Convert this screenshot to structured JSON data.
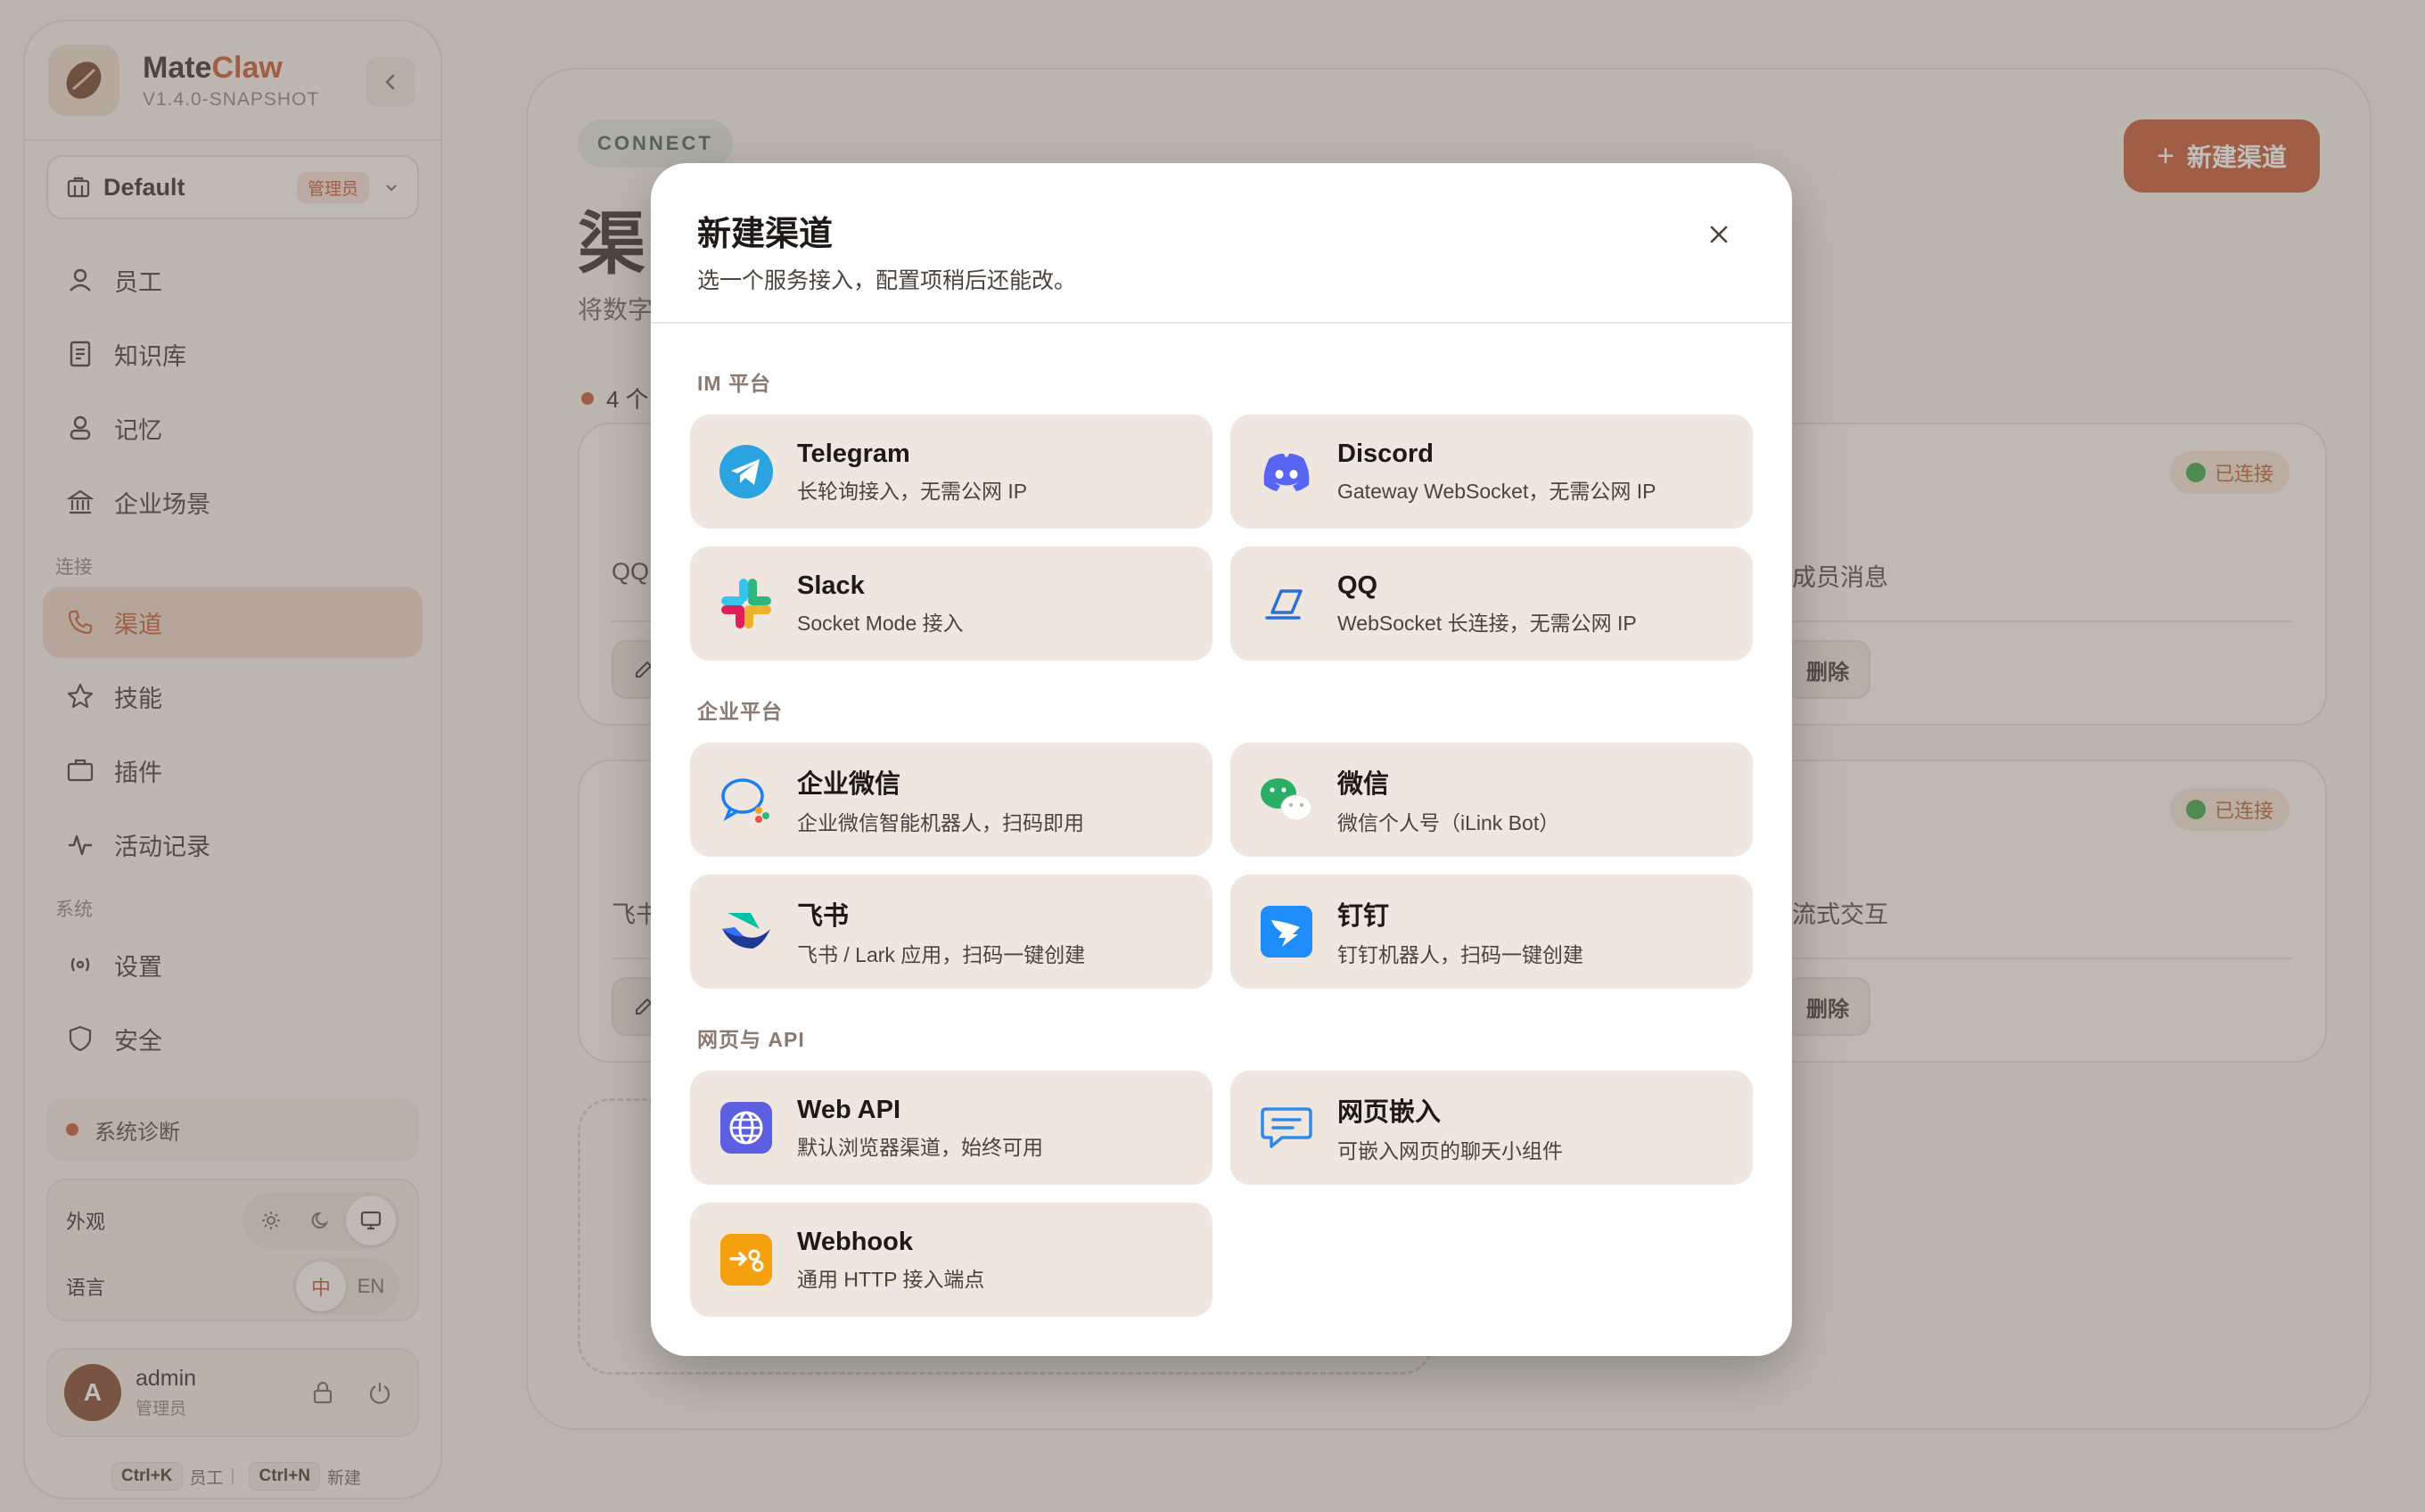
{
  "brand": {
    "name_prefix": "Mate",
    "name_suffix": "Claw",
    "version": "V1.4.0-SNAPSHOT"
  },
  "workspace": {
    "name": "Default",
    "role": "管理员"
  },
  "nav": {
    "items": [
      {
        "label": "员工"
      },
      {
        "label": "知识库"
      },
      {
        "label": "记忆"
      },
      {
        "label": "企业场景"
      }
    ],
    "section_connect": "连接",
    "connect_items": [
      {
        "label": "渠道"
      },
      {
        "label": "技能"
      },
      {
        "label": "插件"
      },
      {
        "label": "活动记录"
      }
    ],
    "section_system": "系统",
    "system_items": [
      {
        "label": "设置"
      },
      {
        "label": "安全"
      }
    ]
  },
  "diagnostics": {
    "label": "系统诊断"
  },
  "prefs": {
    "appearance_label": "外观",
    "language_label": "语言",
    "lang_zh": "中",
    "lang_en": "EN"
  },
  "user": {
    "avatar_letter": "A",
    "name": "admin",
    "role": "管理员"
  },
  "shortcuts": {
    "key1": "Ctrl+K",
    "label1": "员工",
    "key2": "Ctrl+N",
    "label2": "新建"
  },
  "page": {
    "tag": "CONNECT",
    "title_visible": "渠",
    "subtitle_visible": "将数字",
    "count_visible": "4 个",
    "new_button": "新建渠道",
    "card1": {
      "left_text": "QQ",
      "right_text": "回复成员消息",
      "status": "已连接",
      "delete": "删除"
    },
    "card2": {
      "left_text": "飞书",
      "right_text": "浏览器 SSE 流式交互",
      "status": "已连接",
      "delete": "删除"
    }
  },
  "modal": {
    "title": "新建渠道",
    "subtitle": "选一个服务接入，配置项稍后还能改。",
    "sections": [
      {
        "title": "IM 平台",
        "options": [
          {
            "name": "Telegram",
            "desc": "长轮询接入，无需公网 IP",
            "icon": "telegram-icon"
          },
          {
            "name": "Discord",
            "desc": "Gateway WebSocket，无需公网 IP",
            "icon": "discord-icon"
          },
          {
            "name": "Slack",
            "desc": "Socket Mode 接入",
            "icon": "slack-icon"
          },
          {
            "name": "QQ",
            "desc": "WebSocket 长连接，无需公网 IP",
            "icon": "qq-icon"
          }
        ]
      },
      {
        "title": "企业平台",
        "options": [
          {
            "name": "企业微信",
            "desc": "企业微信智能机器人，扫码即用",
            "icon": "wecom-icon"
          },
          {
            "name": "微信",
            "desc": "微信个人号（iLink Bot）",
            "icon": "wechat-icon"
          },
          {
            "name": "飞书",
            "desc": "飞书 / Lark 应用，扫码一键创建",
            "icon": "feishu-icon"
          },
          {
            "name": "钉钉",
            "desc": "钉钉机器人，扫码一键创建",
            "icon": "dingtalk-icon"
          }
        ]
      },
      {
        "title": "网页与 API",
        "options": [
          {
            "name": "Web API",
            "desc": "默认浏览器渠道，始终可用",
            "icon": "globe-icon"
          },
          {
            "name": "网页嵌入",
            "desc": "可嵌入网页的聊天小组件",
            "icon": "chat-bubble-icon"
          },
          {
            "name": "Webhook",
            "desc": "通用 HTTP 接入端点",
            "icon": "webhook-icon"
          }
        ]
      }
    ]
  },
  "colors": {
    "accent": "#c2502a",
    "connected": "#2ea043"
  }
}
